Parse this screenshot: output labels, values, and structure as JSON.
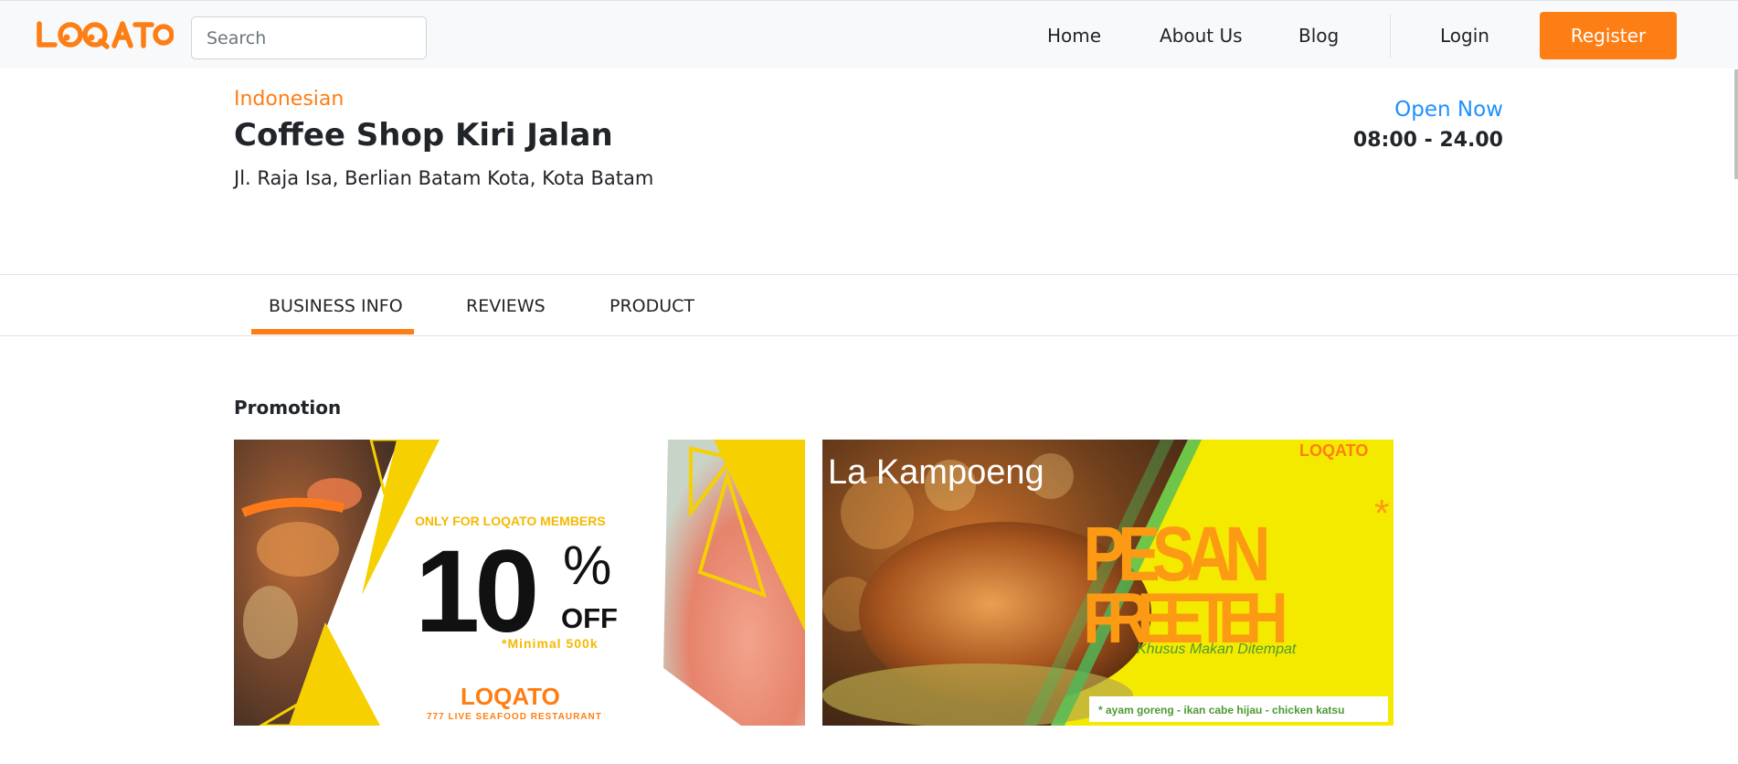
{
  "header": {
    "logo_text": "LOQATO",
    "search_placeholder": "Search",
    "nav": {
      "home": "Home",
      "about": "About Us",
      "blog": "Blog",
      "login": "Login",
      "register": "Register"
    }
  },
  "business": {
    "category": "Indonesian",
    "name": "Coffee Shop Kiri Jalan",
    "address": "Jl. Raja Isa, Berlian Batam Kota, Kota Batam",
    "status": "Open Now",
    "hours": "08:00 - 24.00"
  },
  "tabs": [
    {
      "label": "BUSINESS INFO",
      "active": true
    },
    {
      "label": "REVIEWS",
      "active": false
    },
    {
      "label": "PRODUCT",
      "active": false
    }
  ],
  "promotion": {
    "title": "Promotion",
    "banner1": {
      "tagline": "ONLY FOR LOQATO MEMBERS",
      "percent": "10",
      "percent_sign": "%",
      "off": "OFF",
      "minimal": "*Minimal 500k",
      "logo": "LOQATO",
      "restaurant": "777 LIVE SEAFOOD RESTAURANT"
    },
    "banner2": {
      "restaurant": "La  Kampoeng",
      "logo": "LOQATO",
      "line1": "PESAN",
      "asterisk": "*",
      "line2": "FREE TEH",
      "subtitle": "Khusus Makan Ditempat",
      "footnote": "* ayam goreng - ikan cabe hijau - chicken katsu"
    }
  },
  "colors": {
    "brand": "#fd7e14",
    "link_blue": "#1e90ff",
    "promo_yellow": "#f6d000",
    "banner_yellow": "#f4ea00"
  }
}
